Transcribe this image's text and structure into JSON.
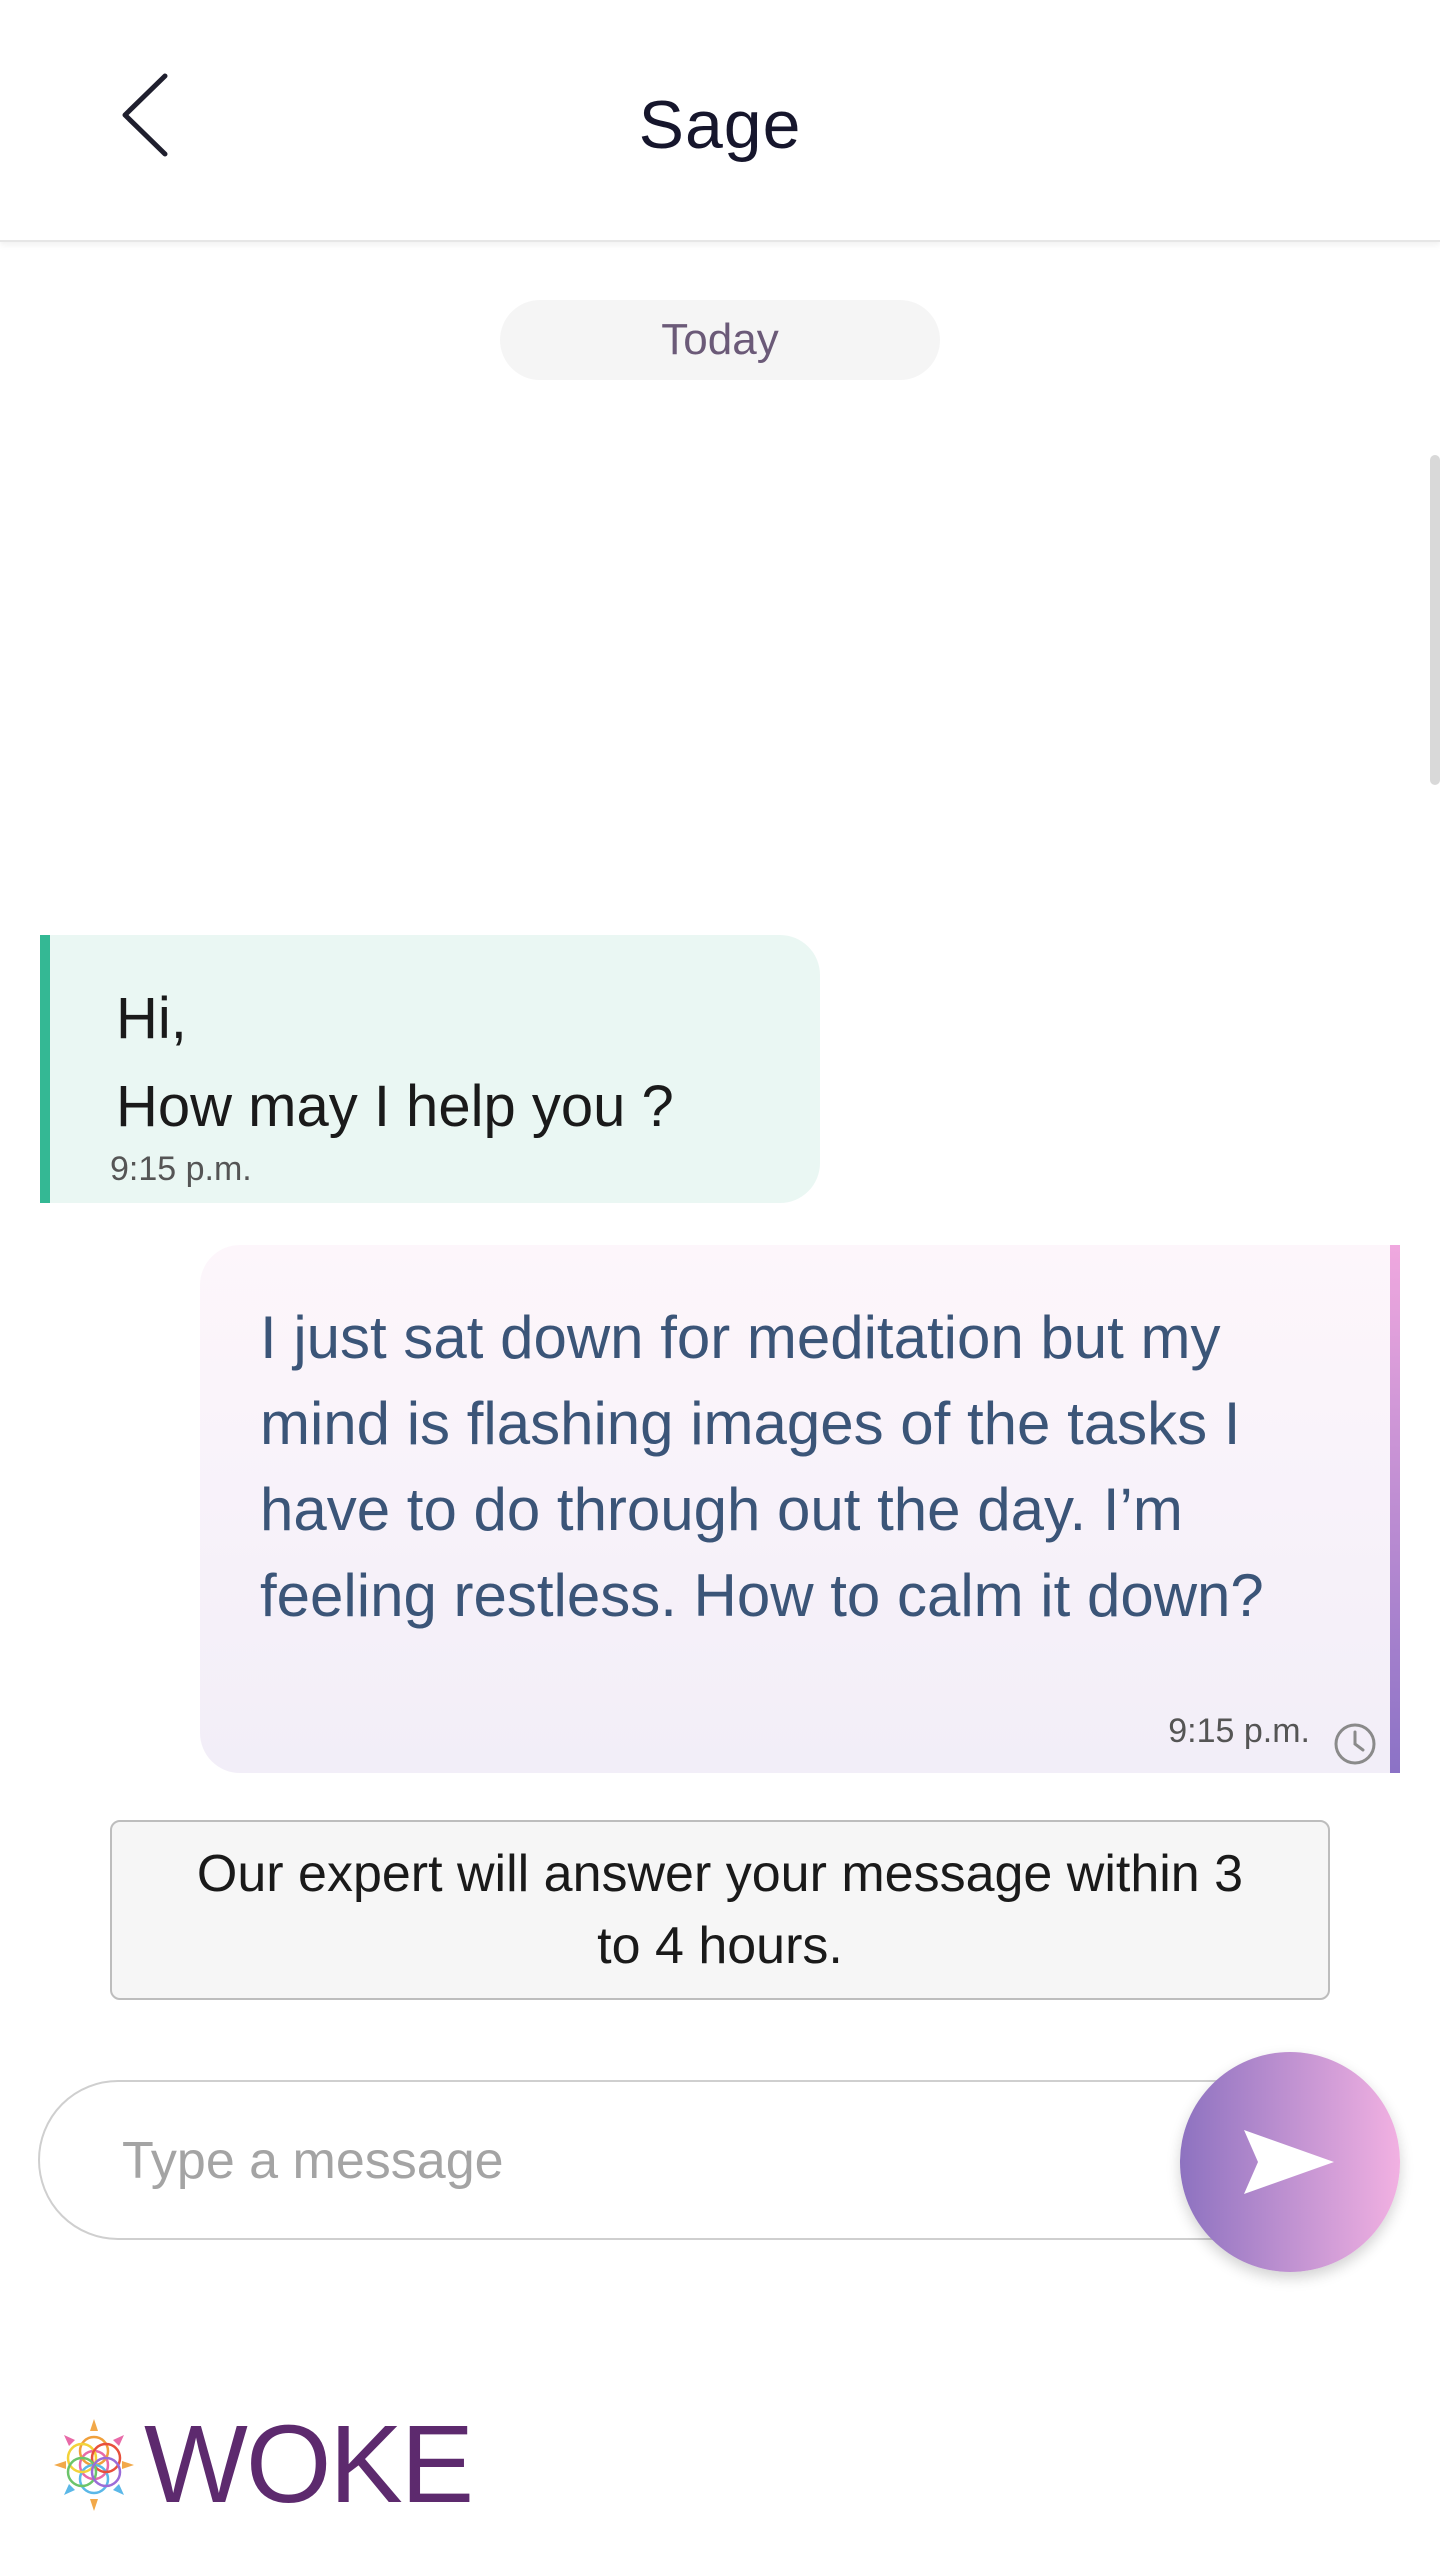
{
  "header": {
    "title": "Sage",
    "back_icon": "chevron-left-icon"
  },
  "chat": {
    "date_divider": "Today",
    "messages": [
      {
        "direction": "incoming",
        "text": "Hi,\nHow may I help you ?",
        "time": "9:15 p.m."
      },
      {
        "direction": "outgoing",
        "text": "I just sat down for meditation but my mind is flashing images of the tasks I have to do through out the day. I’m feeling restless. How to calm it down?",
        "time": "9:15 p.m.",
        "status_icon": "clock-icon"
      }
    ],
    "notice": "Our expert will answer your message within 3 to 4 hours."
  },
  "composer": {
    "placeholder": "Type a message",
    "value": "",
    "send_icon": "send-icon"
  },
  "brand": {
    "name": "WOKE",
    "logo_icon": "flower-of-life-icon"
  },
  "colors": {
    "incoming_accent": "#34b894",
    "outgoing_accent_top": "#f0a8df",
    "outgoing_accent_bottom": "#8b72c6",
    "brand": "#5d2a6e"
  }
}
